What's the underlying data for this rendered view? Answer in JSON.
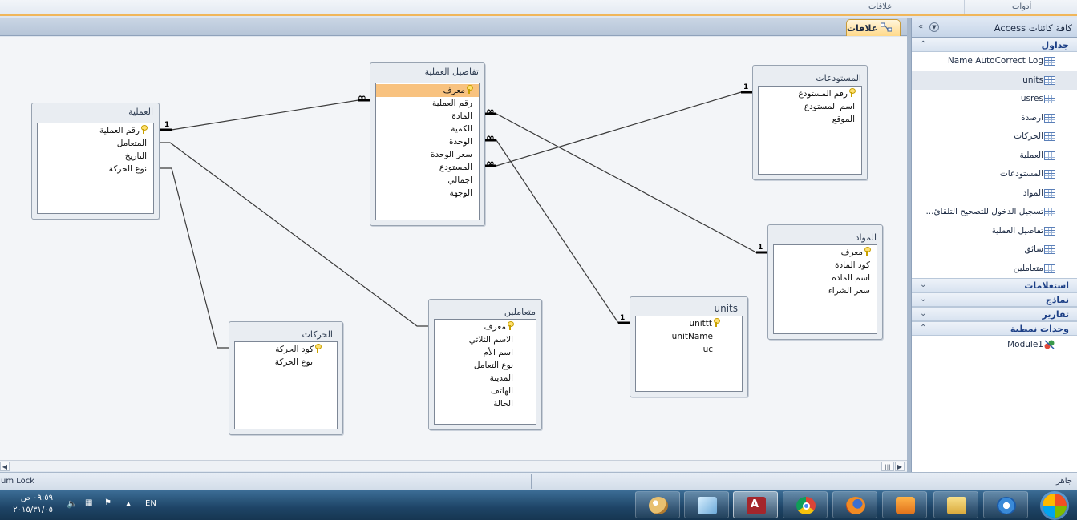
{
  "ribbon": {
    "tools_label": "أدوات",
    "relations_label": "علاقات"
  },
  "document_tab": {
    "label": "علاقات",
    "icon": "relationships-icon"
  },
  "tables": {
    "amaliya": {
      "title": "العملية",
      "fields": [
        "رقم العملية",
        "المتعامل",
        "التاريخ",
        "نوع الحركة"
      ]
    },
    "tafasil": {
      "title": "تفاصيل العملية",
      "fields": [
        "معرف",
        "رقم العملية",
        "المادة",
        "الكمية",
        "الوحدة",
        "سعر الوحدة",
        "المستودع",
        "اجمالي",
        "الوجهة"
      ]
    },
    "mustawdaat": {
      "title": "المستودعات",
      "fields": [
        "رقم المستودع",
        "اسم المستودع",
        "الموقع"
      ]
    },
    "mawad": {
      "title": "المواد",
      "fields": [
        "معرف",
        "كود المادة",
        "اسم المادة",
        "سعر الشراء"
      ]
    },
    "units": {
      "title": "units",
      "fields": [
        "unittt",
        "unitName",
        "uc"
      ]
    },
    "mutaamilin": {
      "title": "متعاملين",
      "fields": [
        "معرف",
        "الاسم الثلاثي",
        "اسم الأم",
        "نوع التعامل",
        "المدينة",
        "الهاتف",
        "الحالة"
      ]
    },
    "harakat": {
      "title": "الحركات",
      "fields": [
        "كود الحركة",
        "نوع الحركة"
      ]
    }
  },
  "relationships": {
    "one_label": "1",
    "many_label": "∞"
  },
  "nav": {
    "title": "كافة كائنات Access",
    "groups": {
      "tables": "جداول",
      "queries": "استعلامات",
      "forms": "نماذج",
      "reports": "تقارير",
      "modules": "وحدات نمطية"
    },
    "table_items": [
      "Name AutoCorrect Log",
      "units",
      "usres",
      "ارصدة",
      "الحركات",
      "العملية",
      "المستودعات",
      "المواد",
      "تسجيل الدخول للتصحيح التلقائ...",
      "تفاصيل العملية",
      "سائق",
      "متعاملين"
    ],
    "module_items": [
      "Module1"
    ]
  },
  "status": {
    "left_text": "um Lock",
    "right_text": "جاهز"
  },
  "taskbar": {
    "clock_time": "٠٩:٥٩ ص",
    "clock_date": "٢٠١٥/٣١/٠٥",
    "language": "EN",
    "apps": [
      "paint-icon",
      "notepad-icon",
      "access-icon",
      "chrome-icon",
      "firefox-icon",
      "media-player-icon",
      "file-explorer-icon",
      "internet-explorer-icon",
      "start-orb-icon"
    ]
  }
}
